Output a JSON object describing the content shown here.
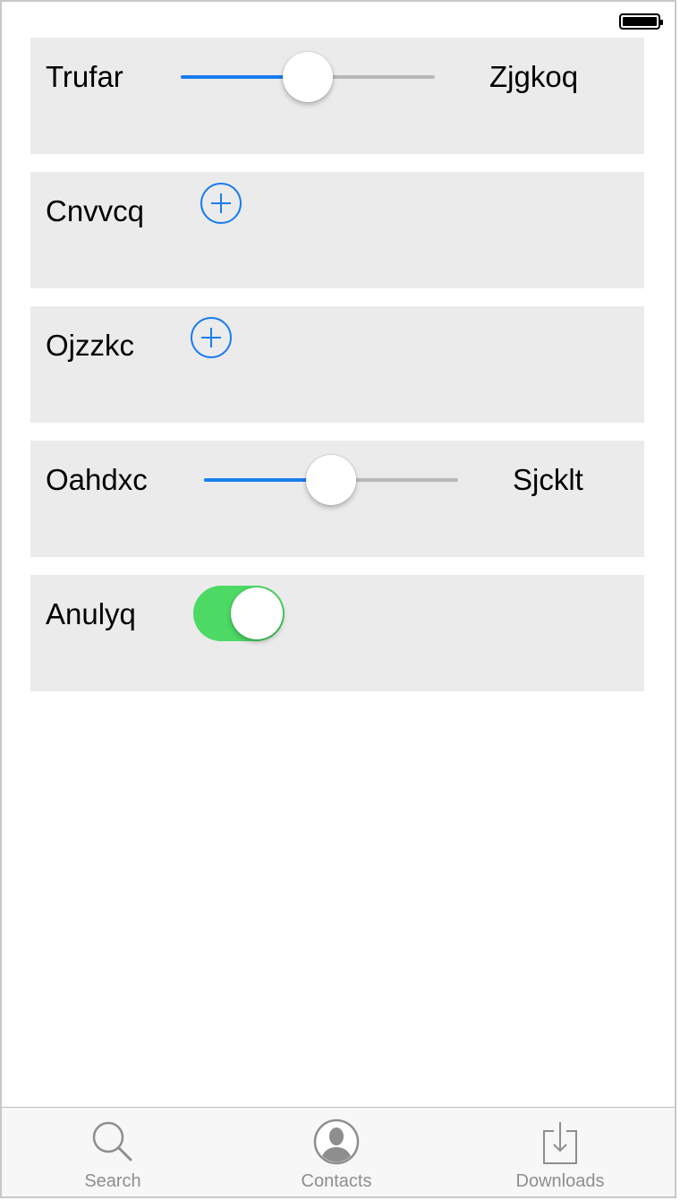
{
  "status_bar": {
    "battery_icon": "battery-icon"
  },
  "rows": [
    {
      "type": "slider",
      "label": "Trufar",
      "value_label": "Zjgkoq",
      "value": 0.5
    },
    {
      "type": "add",
      "label": "Cnvvcq",
      "icon": "plus-circle-icon"
    },
    {
      "type": "add",
      "label": "Ojzzkc",
      "icon": "plus-circle-icon"
    },
    {
      "type": "slider",
      "label": "Oahdxc",
      "value_label": "Sjcklt",
      "value": 0.5
    },
    {
      "type": "toggle",
      "label": "Anulyq",
      "on": true
    }
  ],
  "tabbar": {
    "tabs": [
      {
        "label": "Search",
        "icon": "search-icon"
      },
      {
        "label": "Contacts",
        "icon": "contacts-icon"
      },
      {
        "label": "Downloads",
        "icon": "downloads-icon"
      }
    ]
  },
  "colors": {
    "accent": "#1a7cf0",
    "toggle_on": "#4cd964",
    "row_background": "#ebebeb",
    "tab_inactive": "#8e8e8e"
  }
}
